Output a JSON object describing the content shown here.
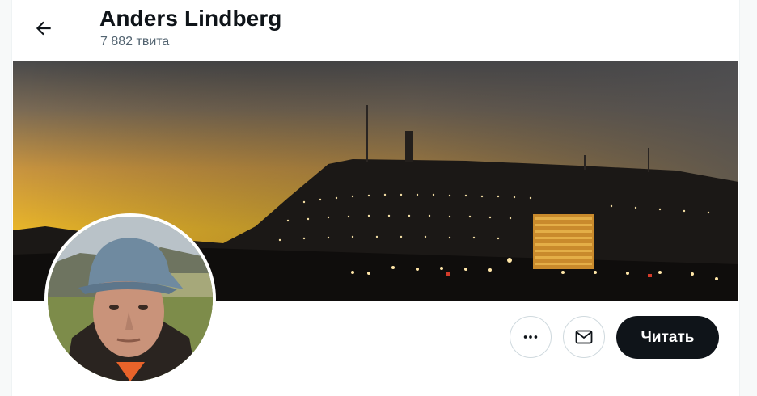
{
  "header": {
    "back_icon": "arrow-left-icon",
    "name": "Anders Lindberg",
    "tweet_count": "7 882 твита"
  },
  "actions": {
    "more_icon": "more-horizontal-icon",
    "message_icon": "envelope-icon",
    "follow_label": "Читать"
  },
  "colors": {
    "primary_text": "#0f1419",
    "secondary_text": "#536471",
    "border": "#cfd9de",
    "follow_button_bg": "#0f1419"
  }
}
